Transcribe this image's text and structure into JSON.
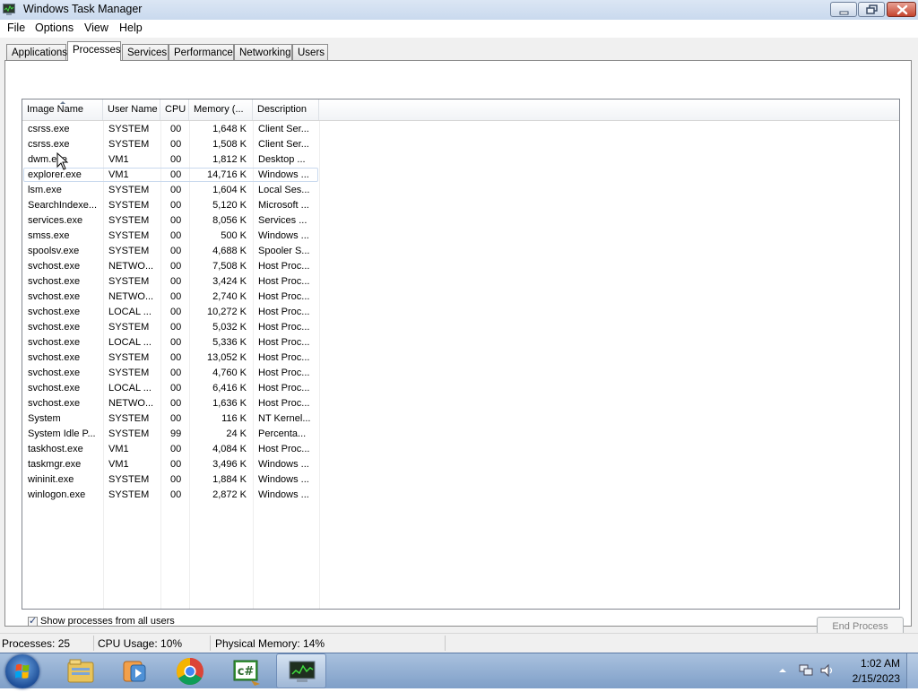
{
  "window": {
    "title": "Windows Task Manager"
  },
  "menu": [
    "File",
    "Options",
    "View",
    "Help"
  ],
  "tabs": [
    "Applications",
    "Processes",
    "Services",
    "Performance",
    "Networking",
    "Users"
  ],
  "active_tab": "Processes",
  "columns": [
    "Image Name",
    "User Name",
    "CPU",
    "Memory (...",
    "Description"
  ],
  "processes": [
    {
      "name": "csrss.exe",
      "user": "SYSTEM",
      "cpu": "00",
      "mem": "1,648 K",
      "desc": "Client Ser..."
    },
    {
      "name": "csrss.exe",
      "user": "SYSTEM",
      "cpu": "00",
      "mem": "1,508 K",
      "desc": "Client Ser..."
    },
    {
      "name": "dwm.exe",
      "user": "VM1",
      "cpu": "00",
      "mem": "1,812 K",
      "desc": "Desktop ..."
    },
    {
      "name": "explorer.exe",
      "user": "VM1",
      "cpu": "00",
      "mem": "14,716 K",
      "desc": "Windows ..."
    },
    {
      "name": "lsm.exe",
      "user": "SYSTEM",
      "cpu": "00",
      "mem": "1,604 K",
      "desc": "Local Ses..."
    },
    {
      "name": "SearchIndexe...",
      "user": "SYSTEM",
      "cpu": "00",
      "mem": "5,120 K",
      "desc": "Microsoft ..."
    },
    {
      "name": "services.exe",
      "user": "SYSTEM",
      "cpu": "00",
      "mem": "8,056 K",
      "desc": "Services ..."
    },
    {
      "name": "smss.exe",
      "user": "SYSTEM",
      "cpu": "00",
      "mem": "500 K",
      "desc": "Windows ..."
    },
    {
      "name": "spoolsv.exe",
      "user": "SYSTEM",
      "cpu": "00",
      "mem": "4,688 K",
      "desc": "Spooler S..."
    },
    {
      "name": "svchost.exe",
      "user": "NETWO...",
      "cpu": "00",
      "mem": "7,508 K",
      "desc": "Host Proc..."
    },
    {
      "name": "svchost.exe",
      "user": "SYSTEM",
      "cpu": "00",
      "mem": "3,424 K",
      "desc": "Host Proc..."
    },
    {
      "name": "svchost.exe",
      "user": "NETWO...",
      "cpu": "00",
      "mem": "2,740 K",
      "desc": "Host Proc..."
    },
    {
      "name": "svchost.exe",
      "user": "LOCAL ...",
      "cpu": "00",
      "mem": "10,272 K",
      "desc": "Host Proc..."
    },
    {
      "name": "svchost.exe",
      "user": "SYSTEM",
      "cpu": "00",
      "mem": "5,032 K",
      "desc": "Host Proc..."
    },
    {
      "name": "svchost.exe",
      "user": "LOCAL ...",
      "cpu": "00",
      "mem": "5,336 K",
      "desc": "Host Proc..."
    },
    {
      "name": "svchost.exe",
      "user": "SYSTEM",
      "cpu": "00",
      "mem": "13,052 K",
      "desc": "Host Proc..."
    },
    {
      "name": "svchost.exe",
      "user": "SYSTEM",
      "cpu": "00",
      "mem": "4,760 K",
      "desc": "Host Proc..."
    },
    {
      "name": "svchost.exe",
      "user": "LOCAL ...",
      "cpu": "00",
      "mem": "6,416 K",
      "desc": "Host Proc..."
    },
    {
      "name": "svchost.exe",
      "user": "NETWO...",
      "cpu": "00",
      "mem": "1,636 K",
      "desc": "Host Proc..."
    },
    {
      "name": "System",
      "user": "SYSTEM",
      "cpu": "00",
      "mem": "116 K",
      "desc": "NT Kernel..."
    },
    {
      "name": "System Idle P...",
      "user": "SYSTEM",
      "cpu": "99",
      "mem": "24 K",
      "desc": "Percenta..."
    },
    {
      "name": "taskhost.exe",
      "user": "VM1",
      "cpu": "00",
      "mem": "4,084 K",
      "desc": "Host Proc..."
    },
    {
      "name": "taskmgr.exe",
      "user": "VM1",
      "cpu": "00",
      "mem": "3,496 K",
      "desc": "Windows ..."
    },
    {
      "name": "wininit.exe",
      "user": "SYSTEM",
      "cpu": "00",
      "mem": "1,884 K",
      "desc": "Windows ..."
    },
    {
      "name": "winlogon.exe",
      "user": "SYSTEM",
      "cpu": "00",
      "mem": "2,872 K",
      "desc": "Windows ..."
    }
  ],
  "selected_row": 3,
  "show_all_users": {
    "label": "Show processes from all users",
    "checked": true,
    "mark": "✓"
  },
  "end_process_label": "End Process",
  "status": {
    "processes": "Processes: 25",
    "cpu": "CPU Usage: 10%",
    "memory": "Physical Memory: 14%"
  },
  "taskbar": {
    "items": [
      "windows-explorer-icon",
      "media-player-icon",
      "chrome-icon",
      "csharp-ide-icon",
      "task-manager-icon"
    ],
    "active_item": "task-manager-icon",
    "time": "1:02 AM",
    "date": "2/15/2023"
  },
  "colors": {
    "title_gradient": "#c9d9ee",
    "close_button": "#c5452e",
    "taskbar": "#7f9fc8"
  }
}
